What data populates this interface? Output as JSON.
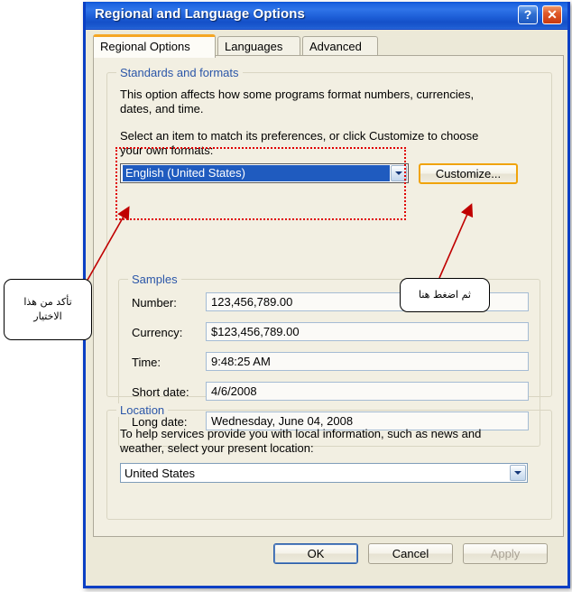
{
  "window": {
    "title": "Regional and Language Options",
    "help_button": "?",
    "close_button": "✕",
    "help_icon": "help-question-icon",
    "close_icon": "close-x-icon"
  },
  "tabs": [
    {
      "label": "Regional Options",
      "active": true
    },
    {
      "label": "Languages",
      "active": false
    },
    {
      "label": "Advanced",
      "active": false
    }
  ],
  "standards": {
    "group_title": "Standards and formats",
    "description_line1": "This option affects how some programs format numbers, currencies,",
    "description_line2": "dates, and time.",
    "instruction_line1": "Select an item to match its preferences, or click Customize to choose",
    "instruction_line2": "your own formats:",
    "locale_value": "English (United States)",
    "customize_label": "Customize..."
  },
  "samples": {
    "group_title": "Samples",
    "rows": [
      {
        "label": "Number:",
        "value": "123,456,789.00"
      },
      {
        "label": "Currency:",
        "value": "$123,456,789.00"
      },
      {
        "label": "Time:",
        "value": "9:48:25 AM"
      },
      {
        "label": "Short date:",
        "value": "4/6/2008"
      },
      {
        "label": "Long date:",
        "value": "Wednesday, June 04, 2008"
      }
    ]
  },
  "location": {
    "group_title": "Location",
    "description_line1": "To help services provide you with local information, such as news and",
    "description_line2": "weather, select your present location:",
    "value": "United States"
  },
  "buttons": {
    "ok": "OK",
    "cancel": "Cancel",
    "apply": "Apply"
  },
  "annotations": {
    "callout_left_line1": "تأكد من هذا",
    "callout_left_line2": "الاختيار",
    "callout_right": "ثم اضغط هنا"
  },
  "colors": {
    "titlebar_blue": "#1d64e0",
    "window_border": "#0a3fc4",
    "dialog_face": "#ece9d8",
    "tabpage_face": "#f2efe2",
    "group_title_blue": "#2b56a8",
    "selection_blue": "#1f5bbf",
    "tab_active_accent": "#f5a623",
    "hot_button_border": "#f0a30a",
    "annotation_red": "#e00000",
    "disabled_text": "#a9a295"
  }
}
